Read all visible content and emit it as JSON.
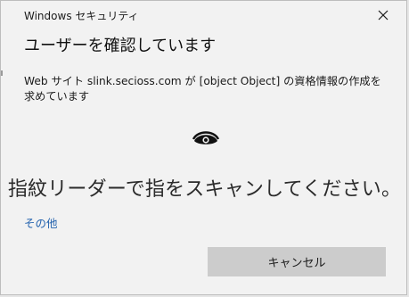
{
  "window": {
    "title": "Windows セキュリティ"
  },
  "dialog": {
    "heading": "ユーザーを確認しています",
    "message": "Web サイト slink.secioss.com が [object Object] の資格情報の作成を求めています",
    "prompt": "指紋リーダーで指をスキャンしてください。",
    "more_link": "その他",
    "cancel_label": "キャンセル",
    "prompt_icon": "fingerprint-icon"
  },
  "colors": {
    "background": "#f2f2f2",
    "link": "#2262ae",
    "button": "#cccccc"
  }
}
